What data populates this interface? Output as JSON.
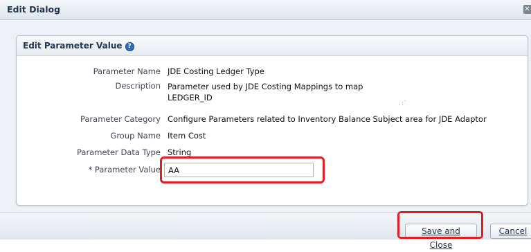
{
  "dialog": {
    "title": "Edit Dialog",
    "close_glyph": "✕"
  },
  "panel": {
    "title": "Edit Parameter Value",
    "help_glyph": "?"
  },
  "fields": {
    "parameter_name": {
      "label": "Parameter Name",
      "value": "JDE Costing Ledger Type"
    },
    "description": {
      "label": "Description",
      "value": "Parameter used by JDE Costing Mappings to map LEDGER_ID"
    },
    "parameter_category": {
      "label": "Parameter Category",
      "value": "Configure Parameters related to Inventory Balance Subject area for JDE Adaptor"
    },
    "group_name": {
      "label": "Group Name",
      "value": "Item Cost"
    },
    "parameter_data_type": {
      "label": "Parameter Data Type",
      "value": "String"
    },
    "parameter_value": {
      "label": "* Parameter Value",
      "value": "AA"
    }
  },
  "footer": {
    "save_label": "Save and Close",
    "cancel_label": "Cancel"
  },
  "colors": {
    "highlight": "#e02020",
    "accent": "#2d6fc3"
  },
  "icons": {
    "help": "help-icon",
    "close": "close-icon"
  }
}
